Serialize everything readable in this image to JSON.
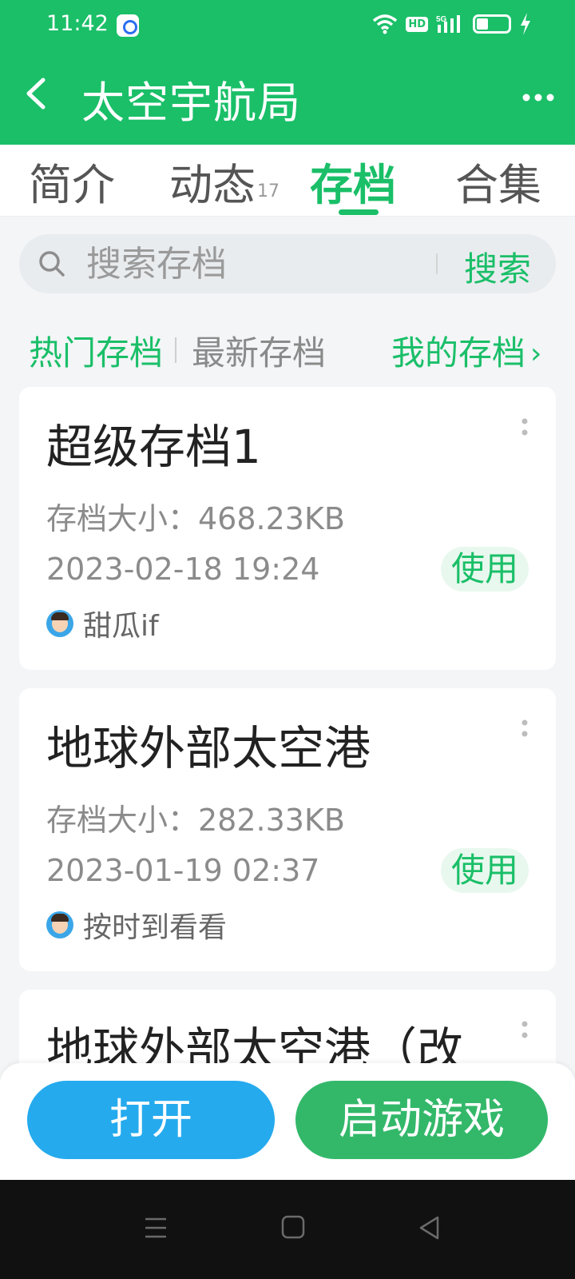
{
  "status_bar": {
    "time": "11:42",
    "network": "5G",
    "hd": "HD",
    "icons": [
      "baidu-app-icon",
      "wifi-icon",
      "hd-icon",
      "signal-5g-icon",
      "battery-icon",
      "charging-icon"
    ]
  },
  "header": {
    "title": "太空宇航局",
    "back_icon": "chevron-left-icon",
    "more_icon": "more-dots-icon"
  },
  "tabs": [
    {
      "label": "简介",
      "count": ""
    },
    {
      "label": "动态",
      "count": "17"
    },
    {
      "label": "存档",
      "count": "",
      "active": true
    },
    {
      "label": "合集",
      "count": ""
    }
  ],
  "search": {
    "placeholder": "搜索存档",
    "button": "搜索"
  },
  "filters": {
    "hot": "热门存档",
    "newest": "最新存档",
    "my_saves": "我的存档",
    "my_saves_chevron": "›"
  },
  "saves": [
    {
      "title": "超级存档1",
      "size": "存档大小：468.23KB",
      "date": "2023-02-18 19:24",
      "author": "甜瓜if",
      "action": "使用"
    },
    {
      "title": "地球外部太空港",
      "size": "存档大小：282.33KB",
      "date": "2023-01-19 02:37",
      "author": "按时到看看",
      "action": "使用"
    },
    {
      "title": "地球外部太空港（改",
      "size": "",
      "date": "",
      "author": "",
      "action": ""
    }
  ],
  "actions": {
    "open": "打开",
    "launch": "启动游戏"
  },
  "colors": {
    "brand_green": "#1abf68",
    "open_blue": "#25aaee",
    "launch_green": "#33b86a",
    "nav_bar": "#111111"
  }
}
